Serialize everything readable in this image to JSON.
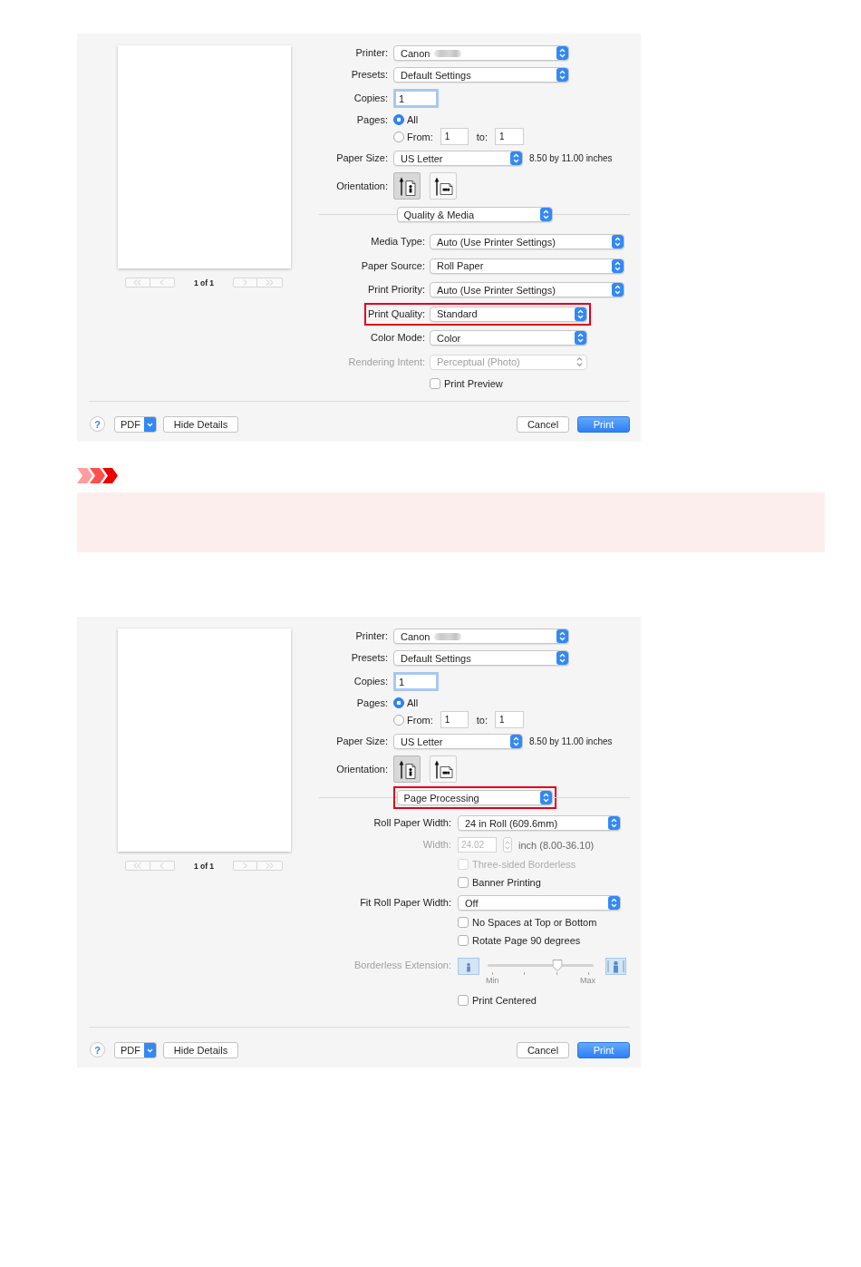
{
  "dialogs": [
    {
      "preview": {
        "page_counter": "1 of 1",
        "nav_disabled": true
      },
      "printer": {
        "label": "Printer:",
        "value": "Canon",
        "model_blurred": true
      },
      "presets": {
        "label": "Presets:",
        "value": "Default Settings"
      },
      "copies": {
        "label": "Copies:",
        "value": "1",
        "focused": true
      },
      "pages": {
        "label": "Pages:",
        "options": [
          {
            "label": "All",
            "selected": true
          },
          {
            "label": "From:",
            "selected": false
          }
        ],
        "from": "1",
        "to_label": "to:",
        "to": "1"
      },
      "paper_size": {
        "label": "Paper Size:",
        "value": "US Letter",
        "dimensions": "8.50 by 11.00 inches"
      },
      "orientation": {
        "label": "Orientation:",
        "options": [
          {
            "kind": "portrait",
            "selected": true
          },
          {
            "kind": "landscape",
            "selected": false
          }
        ]
      },
      "panel_menu": {
        "value": "Quality & Media",
        "highlighted": false
      },
      "settings": [
        {
          "kind": "popup",
          "label": "Media Type:",
          "value": "Auto (Use Printer Settings)",
          "disabled": false,
          "highlighted": false
        },
        {
          "kind": "popup",
          "label": "Paper Source:",
          "value": "Roll Paper",
          "disabled": false,
          "highlighted": false
        },
        {
          "kind": "popup",
          "label": "Print Priority:",
          "value": "Auto (Use Printer Settings)",
          "disabled": false,
          "highlighted": false
        },
        {
          "kind": "popup",
          "label": "Print Quality:",
          "value": "Standard",
          "disabled": false,
          "highlighted": true
        },
        {
          "kind": "popup",
          "label": "Color Mode:",
          "value": "Color",
          "disabled": false,
          "highlighted": false
        },
        {
          "kind": "popup",
          "label": "Rendering Intent:",
          "value": "Perceptual (Photo)",
          "disabled": true,
          "highlighted": false
        },
        {
          "kind": "checkbox",
          "label": "Print Preview",
          "checked": false,
          "disabled": false
        }
      ],
      "footer": {
        "help": "?",
        "pdf": "PDF",
        "details": "Hide Details",
        "buttons": [
          {
            "label": "Cancel",
            "default": false
          },
          {
            "label": "Print",
            "default": true
          }
        ]
      }
    },
    {
      "preview": {
        "page_counter": "1 of 1",
        "nav_disabled": true
      },
      "printer": {
        "label": "Printer:",
        "value": "Canon",
        "model_blurred": true
      },
      "presets": {
        "label": "Presets:",
        "value": "Default Settings"
      },
      "copies": {
        "label": "Copies:",
        "value": "1",
        "focused": true
      },
      "pages": {
        "label": "Pages:",
        "options": [
          {
            "label": "All",
            "selected": true
          },
          {
            "label": "From:",
            "selected": false
          }
        ],
        "from": "1",
        "to_label": "to:",
        "to": "1"
      },
      "paper_size": {
        "label": "Paper Size:",
        "value": "US Letter",
        "dimensions": "8.50 by 11.00 inches"
      },
      "orientation": {
        "label": "Orientation:",
        "options": [
          {
            "kind": "portrait",
            "selected": true
          },
          {
            "kind": "landscape",
            "selected": false
          }
        ]
      },
      "panel_menu": {
        "value": "Page Processing",
        "highlighted": true
      },
      "settings": [
        {
          "kind": "popup",
          "label": "Roll Paper Width:",
          "value": "24 in Roll (609.6mm)",
          "disabled": false,
          "highlighted": false
        },
        {
          "kind": "number",
          "label": "Width:",
          "value": "24.02",
          "unit": "inch (8.00-36.10)",
          "disabled": true
        },
        {
          "kind": "checkbox",
          "label": "Three-sided Borderless",
          "checked": false,
          "disabled": true
        },
        {
          "kind": "checkbox",
          "label": "Banner Printing",
          "checked": false,
          "disabled": false
        },
        {
          "kind": "popup",
          "label": "Fit Roll Paper Width:",
          "value": "Off",
          "disabled": false,
          "highlighted": false
        },
        {
          "kind": "checkbox",
          "label": "No Spaces at Top or Bottom",
          "checked": false,
          "disabled": false
        },
        {
          "kind": "checkbox",
          "label": "Rotate Page 90 degrees",
          "checked": false,
          "disabled": false
        },
        {
          "kind": "slider",
          "label": "Borderless Extension:",
          "level": 0.67,
          "min_label": "Min",
          "max_label": "Max",
          "disabled": true
        },
        {
          "kind": "checkbox",
          "label": "Print Centered",
          "checked": false,
          "disabled": false
        }
      ],
      "footer": {
        "help": "?",
        "pdf": "PDF",
        "details": "Hide Details",
        "buttons": [
          {
            "label": "Cancel",
            "default": false
          },
          {
            "label": "Print",
            "default": true
          }
        ]
      }
    }
  ]
}
